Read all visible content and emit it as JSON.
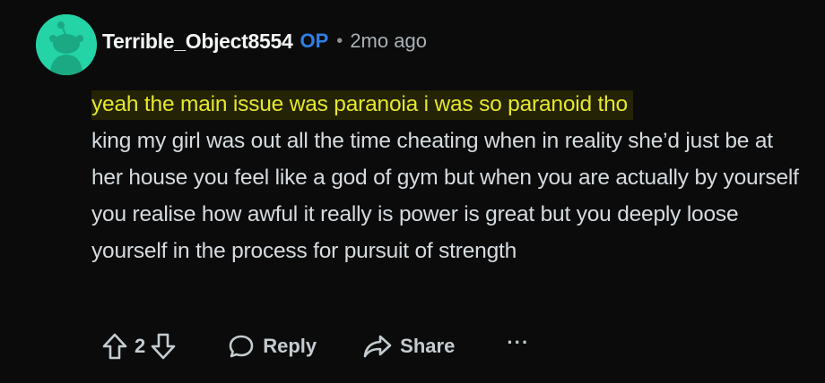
{
  "comment": {
    "author": "Terrible_Object8554",
    "op_badge": "OP",
    "separator": "•",
    "timestamp": "2mo ago",
    "highlighted_text": "yeah the main issue was paranoia i was so paranoid tho",
    "body_text": "king my girl was out all the time cheating when in reality she’d just be at her house you feel like a god of gym but when you are actually by yourself you realise how awful it really is power is great but you deeply loose yourself in the process for pursuit of strength",
    "avatar_icon": "reddit-snoo-avatar-icon"
  },
  "actions": {
    "upvote_icon": "upvote-arrow-icon",
    "vote_count": "2",
    "downvote_icon": "downvote-arrow-icon",
    "reply_label": "Reply",
    "reply_icon": "speech-bubble-icon",
    "share_label": "Share",
    "share_icon": "share-arrow-icon",
    "more_label": "···"
  },
  "colors": {
    "background": "#0b0b0b",
    "avatar": "#24d3a6",
    "op_badge": "#2f7fe6",
    "highlight_bg": "#242306",
    "highlight_text": "#e5e82b",
    "body_text": "#d5dbdf"
  }
}
